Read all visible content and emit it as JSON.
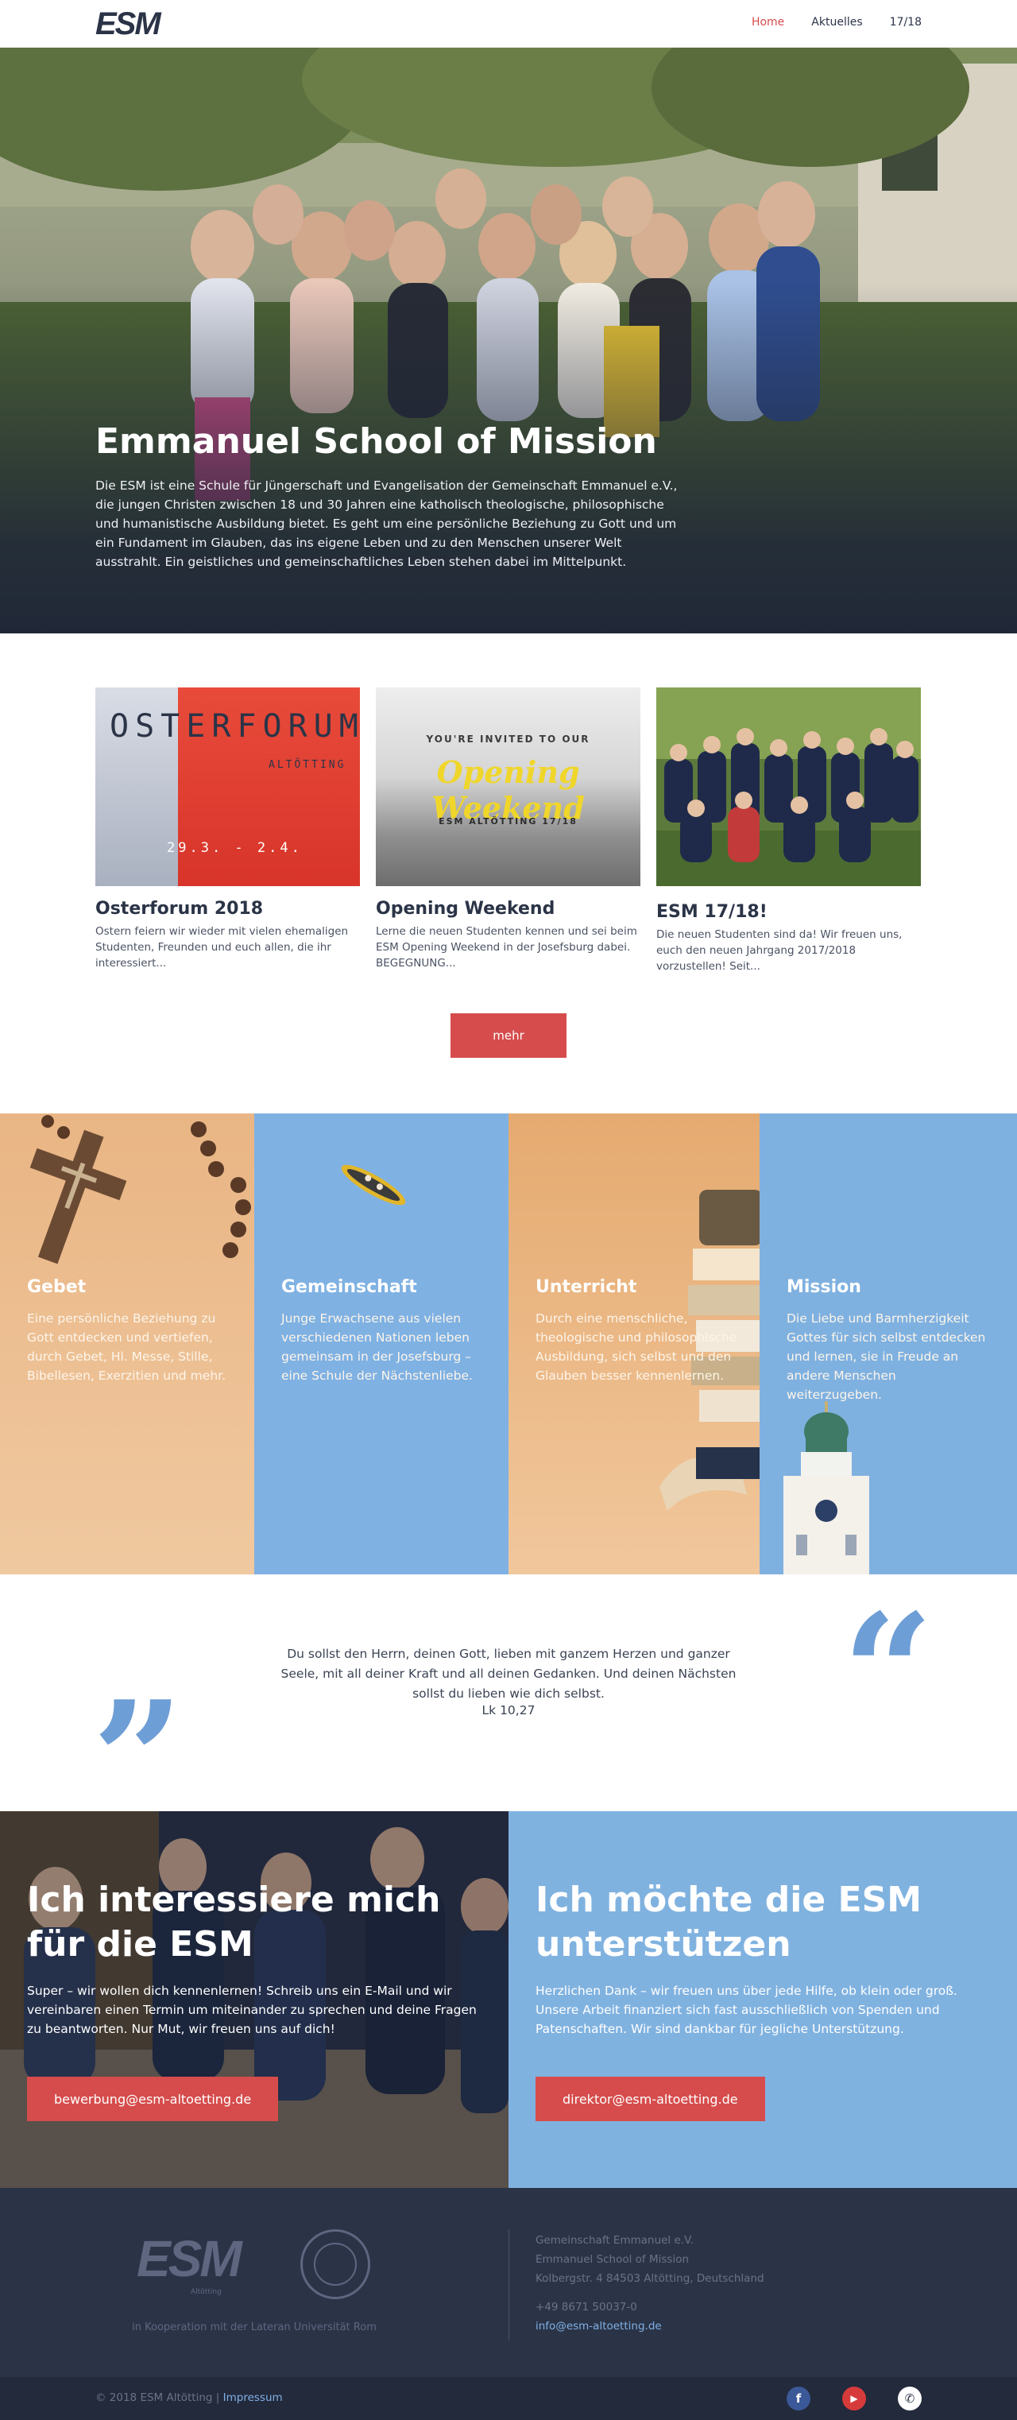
{
  "header": {
    "logo": "ESM",
    "nav": [
      {
        "label": "Home",
        "active": true
      },
      {
        "label": "Aktuelles",
        "active": false
      },
      {
        "label": "17/18",
        "active": false
      }
    ]
  },
  "hero": {
    "title": "Emmanuel School of Mission",
    "text": "Die ESM ist eine Schule für Jüngerschaft und Evangelisation der Gemeinschaft Emmanuel e.V., die jungen Christen zwischen 18 und 30 Jahren eine katholisch theologische, philosophische und humanistische Ausbildung bietet. Es geht um eine persönliche Beziehung zu Gott und um ein Fundament im Glauben, das ins eigene Leben und zu den Menschen unserer Welt ausstrahlt. Ein geistliches und gemeinschaftliches Leben stehen dabei im Mittelpunkt."
  },
  "news": {
    "cards": [
      {
        "title": "Osterforum 2018",
        "text": "Ostern feiern wir wieder mit vielen ehemaligen Studenten, Freunden und euch allen, die ihr interessiert...",
        "image_heading": "OSTERFORUM",
        "image_sub": "ALTÖTTING",
        "image_date": "29.3. - 2.4."
      },
      {
        "title": "Opening Weekend",
        "text": "Lerne die neuen Studenten kennen und sei beim ESM Opening Weekend in der Josefsburg dabei. BEGEGNUNG...",
        "image_invite": "YOU'RE INVITED TO OUR",
        "image_heading": "Opening Weekend",
        "image_sub": "ESM ALTÖTTING 17/18"
      },
      {
        "title": "ESM 17/18!",
        "text": "Die neuen Studenten sind da! Wir freuen uns, euch den neuen Jahrgang 2017/2018 vorzustellen! Seit..."
      }
    ],
    "more_label": "mehr"
  },
  "pillars": [
    {
      "title": "Gebet",
      "text": "Eine persönliche Beziehung zu Gott entdecken und vertiefen, durch Gebet, Hl. Messe, Stille, Bibellesen, Exerzitien und mehr.",
      "color": "#e8b88a"
    },
    {
      "title": "Gemeinschaft",
      "text": "Junge Erwachsene aus vielen verschiedenen Nationen leben gemeinsam in der Josefsburg – eine Schule der Nächstenliebe.",
      "color": "#7fb1e3"
    },
    {
      "title": "Unterricht",
      "text": "Durch eine menschliche, theologische und philosophische Ausbildung, sich selbst und den Glauben besser kennenlernen.",
      "color": "#e9b788"
    },
    {
      "title": "Mission",
      "text": "Die Liebe und Barmherzigkeit Gottes für sich selbst entdecken und lernen, sie in Freude an andere Menschen weiterzugeben.",
      "color": "#7fb1e0"
    }
  ],
  "quote": {
    "text": "Du sollst den Herrn, deinen Gott, lieben mit ganzem Herzen und ganzer Seele, mit all deiner Kraft und all deinen Gedanken. Und deinen Nächsten sollst du lieben wie dich selbst.",
    "reference": "Lk 10,27"
  },
  "cta": {
    "left": {
      "title": "Ich interessiere mich für die ESM",
      "text": "Super – wir wollen dich kennenlernen! Schreib uns ein E-Mail und wir vereinbaren einen Termin um miteinander zu sprechen und deine Fragen zu beantworten. Nur Mut, wir freuen uns auf dich!",
      "button": "bewerbung@esm-altoetting.de"
    },
    "right": {
      "title": "Ich möchte die ESM unterstützen",
      "text": "Herzlichen Dank – wir freuen uns über jede Hilfe, ob klein oder groß. Unsere Arbeit finanziert sich fast ausschließlich von Spenden und Patenschaften. Wir sind dankbar für jegliche Unterstützung.",
      "button": "direktor@esm-altoetting.de"
    }
  },
  "footer": {
    "logo": "ESM",
    "logo_sub": "Altötting",
    "cooperation": "in Kooperation mit der Lateran Universität Rom",
    "address": [
      "Gemeinschaft Emmanuel e.V.",
      "Emmanuel School of Mission",
      "Kolbergstr. 4 84503 Altötting, Deutschland"
    ],
    "phone": "+49 8671 50037-0",
    "email": "info@esm-altoetting.de"
  },
  "bottombar": {
    "copyright": "© 2018 ESM Altötting |",
    "impressum": "Impressum",
    "social": [
      {
        "icon": "facebook-icon",
        "glyph": "f",
        "color": "#3b5998"
      },
      {
        "icon": "youtube-icon",
        "glyph": "▶",
        "color": "#d63b3b"
      },
      {
        "icon": "whatsapp-icon",
        "glyph": "✆",
        "color": "#ffffff"
      }
    ]
  }
}
